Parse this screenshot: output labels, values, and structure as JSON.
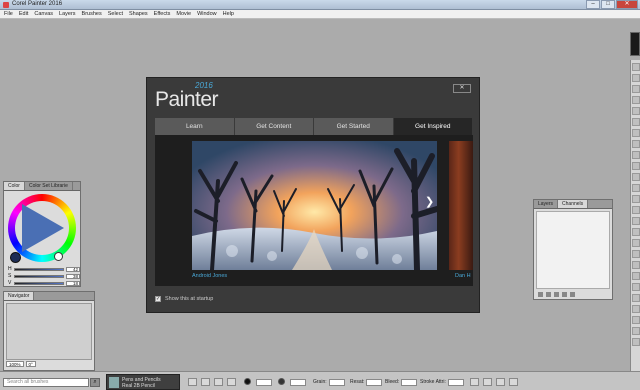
{
  "window": {
    "title": "Corel Painter 2016",
    "controls": {
      "minimize": "–",
      "maximize": "□",
      "close": "✕"
    }
  },
  "menu": [
    "File",
    "Edit",
    "Canvas",
    "Layers",
    "Brushes",
    "Select",
    "Shapes",
    "Effects",
    "Movie",
    "Window",
    "Help"
  ],
  "dialog": {
    "brand": "Painter",
    "brand_year": "2016",
    "close_label": "✕",
    "tabs": [
      "Learn",
      "Get Content",
      "Get Started",
      "Get Inspired"
    ],
    "active_tab": "Get Inspired",
    "next_icon": "chevron-right-icon",
    "caption_left": "Android Jones",
    "caption_right": "Dan H",
    "show_startup_label": "Show this at startup",
    "show_startup_checked": true
  },
  "color_panel": {
    "tabs": [
      "Color",
      "Color Set Librarie"
    ],
    "sliders": [
      {
        "key": "H",
        "value": "42"
      },
      {
        "key": "S",
        "value": "38"
      },
      {
        "key": "V",
        "value": "18"
      }
    ]
  },
  "navigator_panel": {
    "tabs": [
      "Navigator"
    ],
    "zoom": "100%",
    "angle": "0°"
  },
  "layers_panel": {
    "tabs": [
      "Layers",
      "Channels"
    ]
  },
  "property_bar": {
    "search_placeholder": "Search all brushes",
    "brush_category": "Pens and Pencils",
    "brush_variant": "Real 2B Pencil",
    "size_label": "",
    "size_value": "",
    "opacity_label": "",
    "opacity_value": "",
    "grain_label": "Grain:",
    "grain_value": "",
    "resat_label": "Resat:",
    "resat_value": "",
    "bleed_label": "Bleed:",
    "bleed_value": "",
    "stroke_label": "Stroke Attri:",
    "stroke_value": ""
  },
  "colors": {
    "accent": "#4aa9d8",
    "dialog_bg": "#3a3a3a",
    "workspace": "#ababab"
  }
}
